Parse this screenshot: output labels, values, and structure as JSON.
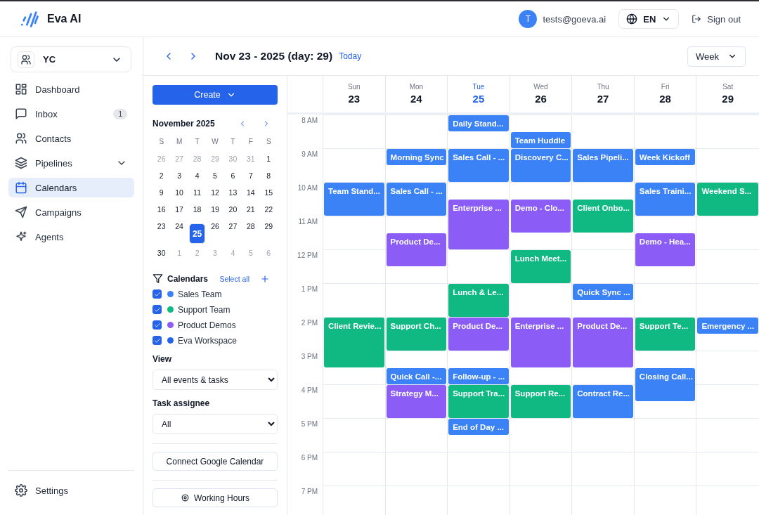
{
  "brand": {
    "name": "Eva AI"
  },
  "header": {
    "avatar_initial": "T",
    "email": "tests@goeva.ai",
    "language": "EN",
    "sign_out": "Sign out"
  },
  "workspace": {
    "name": "YC"
  },
  "sidebar": {
    "items": [
      {
        "label": "Dashboard",
        "selected": false
      },
      {
        "label": "Inbox",
        "badge": "1",
        "selected": false
      },
      {
        "label": "Contacts",
        "selected": false
      },
      {
        "label": "Pipelines",
        "expandable": true,
        "selected": false
      },
      {
        "label": "Calendars",
        "selected": true
      },
      {
        "label": "Campaigns",
        "selected": false
      },
      {
        "label": "Agents",
        "selected": false
      }
    ],
    "settings": "Settings"
  },
  "toolbar": {
    "range": "Nov 23 - 2025 (day: 29)",
    "today": "Today",
    "view": "Week"
  },
  "panel": {
    "create": "Create",
    "mini_calendar": {
      "month": "November 2025",
      "weekdays": [
        "S",
        "M",
        "T",
        "W",
        "T",
        "F",
        "S"
      ],
      "weeks": [
        [
          {
            "d": "26",
            "muted": true,
            "selected": false
          },
          {
            "d": "27",
            "muted": true,
            "selected": false
          },
          {
            "d": "28",
            "muted": true,
            "selected": false
          },
          {
            "d": "29",
            "muted": true,
            "selected": false
          },
          {
            "d": "30",
            "muted": true,
            "selected": false
          },
          {
            "d": "31",
            "muted": true,
            "selected": false
          },
          {
            "d": "1",
            "muted": false,
            "selected": false
          }
        ],
        [
          {
            "d": "2",
            "muted": false,
            "selected": false
          },
          {
            "d": "3",
            "muted": false,
            "selected": false
          },
          {
            "d": "4",
            "muted": false,
            "selected": false
          },
          {
            "d": "5",
            "muted": false,
            "selected": false
          },
          {
            "d": "6",
            "muted": false,
            "selected": false
          },
          {
            "d": "7",
            "muted": false,
            "selected": false
          },
          {
            "d": "8",
            "muted": false,
            "selected": false
          }
        ],
        [
          {
            "d": "9",
            "muted": false,
            "selected": false
          },
          {
            "d": "10",
            "muted": false,
            "selected": false
          },
          {
            "d": "11",
            "muted": false,
            "selected": false
          },
          {
            "d": "12",
            "muted": false,
            "selected": false
          },
          {
            "d": "13",
            "muted": false,
            "selected": false
          },
          {
            "d": "14",
            "muted": false,
            "selected": false
          },
          {
            "d": "15",
            "muted": false,
            "selected": false
          }
        ],
        [
          {
            "d": "16",
            "muted": false,
            "selected": false
          },
          {
            "d": "17",
            "muted": false,
            "selected": false
          },
          {
            "d": "18",
            "muted": false,
            "selected": false
          },
          {
            "d": "19",
            "muted": false,
            "selected": false
          },
          {
            "d": "20",
            "muted": false,
            "selected": false
          },
          {
            "d": "21",
            "muted": false,
            "selected": false
          },
          {
            "d": "22",
            "muted": false,
            "selected": false
          }
        ],
        [
          {
            "d": "23",
            "muted": false,
            "selected": false
          },
          {
            "d": "24",
            "muted": false,
            "selected": false
          },
          {
            "d": "25",
            "muted": false,
            "selected": true
          },
          {
            "d": "26",
            "muted": false,
            "selected": false
          },
          {
            "d": "27",
            "muted": false,
            "selected": false
          },
          {
            "d": "28",
            "muted": false,
            "selected": false
          },
          {
            "d": "29",
            "muted": false,
            "selected": false
          }
        ],
        [
          {
            "d": "30",
            "muted": false,
            "selected": false
          },
          {
            "d": "1",
            "muted": true,
            "selected": false
          },
          {
            "d": "2",
            "muted": true,
            "selected": false
          },
          {
            "d": "3",
            "muted": true,
            "selected": false
          },
          {
            "d": "4",
            "muted": true,
            "selected": false
          },
          {
            "d": "5",
            "muted": true,
            "selected": false
          },
          {
            "d": "6",
            "muted": true,
            "selected": false
          }
        ]
      ]
    },
    "calendars_title": "Calendars",
    "select_all": "Select all",
    "calendars": [
      {
        "name": "Sales Team",
        "color": "#3b82f6",
        "checked": true
      },
      {
        "name": "Support Team",
        "color": "#10b981",
        "checked": true
      },
      {
        "name": "Product Demos",
        "color": "#8b5cf6",
        "checked": true
      },
      {
        "name": "Eva Workspace",
        "color": "#2563eb",
        "checked": true
      }
    ],
    "view_label": "View",
    "view_value": "All events & tasks",
    "assignee_label": "Task assignee",
    "assignee_value": "All",
    "connect": "Connect Google Calendar",
    "working_hours": "Working Hours"
  },
  "week": {
    "hours": [
      "8 AM",
      "9 AM",
      "10 AM",
      "11 AM",
      "12 PM",
      "1 PM",
      "2 PM",
      "3 PM",
      "4 PM",
      "5 PM",
      "6 PM",
      "7 PM"
    ],
    "days": [
      {
        "name": "Sun",
        "date": "23",
        "selected": false,
        "events": [
          {
            "title": "Team Stand...",
            "color": "#3b82f6"
          },
          {
            "title": "Client Revie...",
            "color": "#10b981"
          }
        ]
      },
      {
        "name": "Mon",
        "date": "24",
        "selected": false,
        "events": [
          {
            "title": "Morning Sync",
            "color": "#3b82f6"
          },
          {
            "title": "Sales Call - ...",
            "color": "#3b82f6"
          },
          {
            "title": "Product De...",
            "color": "#8b5cf6"
          },
          {
            "title": "Support Ch...",
            "color": "#10b981"
          },
          {
            "title": "Quick Call -...",
            "color": "#3b82f6"
          },
          {
            "title": "Strategy M...",
            "color": "#8b5cf6"
          }
        ]
      },
      {
        "name": "Tue",
        "date": "25",
        "selected": true,
        "events": [
          {
            "title": "Daily Stand...",
            "color": "#3b82f6"
          },
          {
            "title": "Sales Call - ...",
            "color": "#3b82f6"
          },
          {
            "title": "Enterprise ...",
            "color": "#8b5cf6"
          },
          {
            "title": "Lunch & Le...",
            "color": "#10b981"
          },
          {
            "title": "Product De...",
            "color": "#8b5cf6"
          },
          {
            "title": "Follow-up - ...",
            "color": "#3b82f6"
          },
          {
            "title": "Support Tra...",
            "color": "#10b981"
          },
          {
            "title": "End of Day ...",
            "color": "#3b82f6"
          }
        ]
      },
      {
        "name": "Wed",
        "date": "26",
        "selected": false,
        "events": [
          {
            "title": "Team Huddle",
            "color": "#3b82f6"
          },
          {
            "title": "Discovery C...",
            "color": "#3b82f6"
          },
          {
            "title": "Demo - Clo...",
            "color": "#8b5cf6"
          },
          {
            "title": "Lunch Meet...",
            "color": "#10b981"
          },
          {
            "title": "Enterprise ...",
            "color": "#8b5cf6"
          },
          {
            "title": "Support Re...",
            "color": "#10b981"
          }
        ]
      },
      {
        "name": "Thu",
        "date": "27",
        "selected": false,
        "events": [
          {
            "title": "Sales Pipeli...",
            "color": "#3b82f6"
          },
          {
            "title": "Client Onbo...",
            "color": "#10b981"
          },
          {
            "title": "Quick Sync ...",
            "color": "#3b82f6"
          },
          {
            "title": "Product De...",
            "color": "#8b5cf6"
          },
          {
            "title": "Contract Re...",
            "color": "#3b82f6"
          }
        ]
      },
      {
        "name": "Fri",
        "date": "28",
        "selected": false,
        "events": [
          {
            "title": "Week Kickoff",
            "color": "#3b82f6"
          },
          {
            "title": "Sales Traini...",
            "color": "#3b82f6"
          },
          {
            "title": "Demo - Hea...",
            "color": "#8b5cf6"
          },
          {
            "title": "Support Te...",
            "color": "#10b981"
          },
          {
            "title": "Closing Call...",
            "color": "#3b82f6"
          }
        ]
      },
      {
        "name": "Sat",
        "date": "29",
        "selected": false,
        "events": [
          {
            "title": "Weekend S...",
            "color": "#10b981"
          },
          {
            "title": "Emergency ...",
            "color": "#3b82f6"
          }
        ]
      }
    ]
  }
}
